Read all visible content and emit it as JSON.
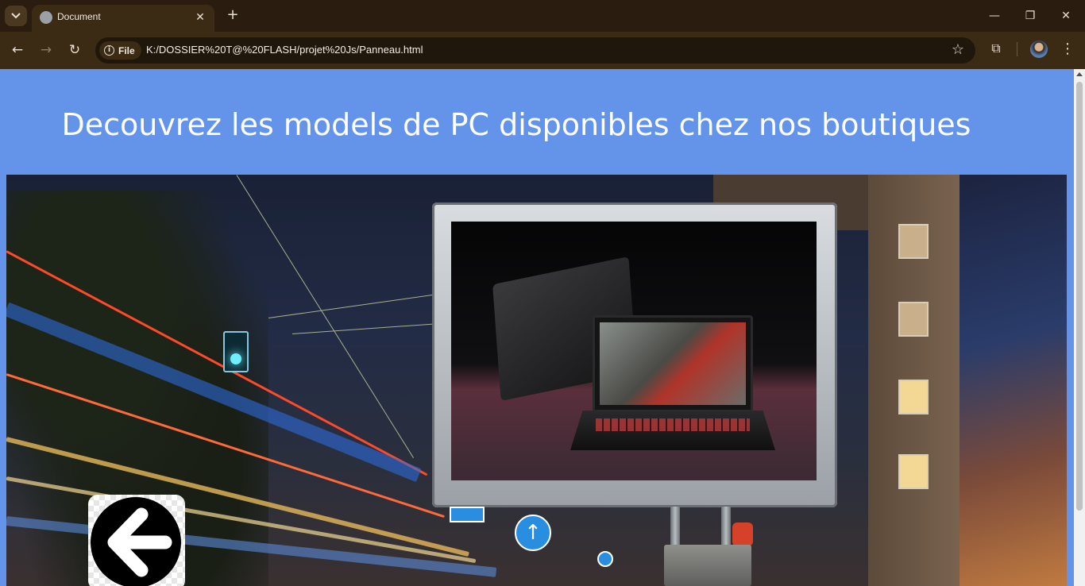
{
  "browser": {
    "tab_title": "Document",
    "site_chip_label": "File",
    "url": "K:/DOSSIER%20T@%20FLASH/projet%20Js/Panneau.html"
  },
  "page": {
    "heading": "Decouvrez les models de PC disponibles chez nos boutiques",
    "background_color": "#6493ea"
  },
  "icons": {
    "back": "arrow-left-icon",
    "bookmark": "star-icon",
    "extensions": "puzzle-icon"
  }
}
